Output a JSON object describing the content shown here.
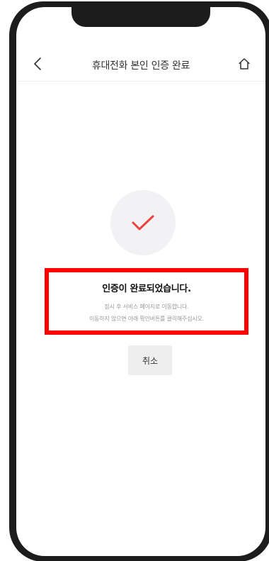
{
  "header": {
    "title": "휴대전화 본인 인증 완료",
    "back_icon": "chevron-left-icon",
    "home_icon": "home-icon"
  },
  "status": {
    "icon": "checkmark-icon",
    "icon_color": "#e8433f",
    "circle_color": "#f2f2f4"
  },
  "message": {
    "title": "인증이 완료되었습니다.",
    "line1": "잠시 후 서비스 페이지로 이동합니다.",
    "line2": "이동하지 않으면 아래 확인버튼를 클릭해주십시오.",
    "highlight_color": "#ff0000"
  },
  "actions": {
    "cancel_label": "취소"
  }
}
